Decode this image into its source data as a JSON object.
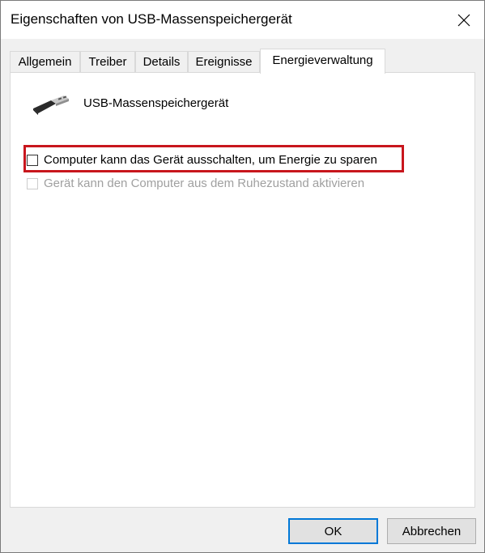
{
  "window": {
    "title": "Eigenschaften von USB-Massenspeichergerät",
    "close_icon": "close-icon"
  },
  "tabs": [
    {
      "label": "Allgemein",
      "active": false
    },
    {
      "label": "Treiber",
      "active": false
    },
    {
      "label": "Details",
      "active": false
    },
    {
      "label": "Ereignisse",
      "active": false
    },
    {
      "label": "Energieverwaltung",
      "active": true
    }
  ],
  "device": {
    "name": "USB-Massenspeichergerät",
    "icon": "usb-plug-icon"
  },
  "options": [
    {
      "label": "Computer kann das Gerät ausschalten, um Energie zu sparen",
      "checked": false,
      "enabled": true,
      "highlighted": true
    },
    {
      "label": "Gerät kann den Computer aus dem Ruhezustand aktivieren",
      "checked": false,
      "enabled": false,
      "highlighted": false
    }
  ],
  "buttons": {
    "ok_label": "OK",
    "cancel_label": "Abbrechen"
  },
  "colors": {
    "highlight": "#c8161d",
    "default_button_border": "#0078d7"
  }
}
